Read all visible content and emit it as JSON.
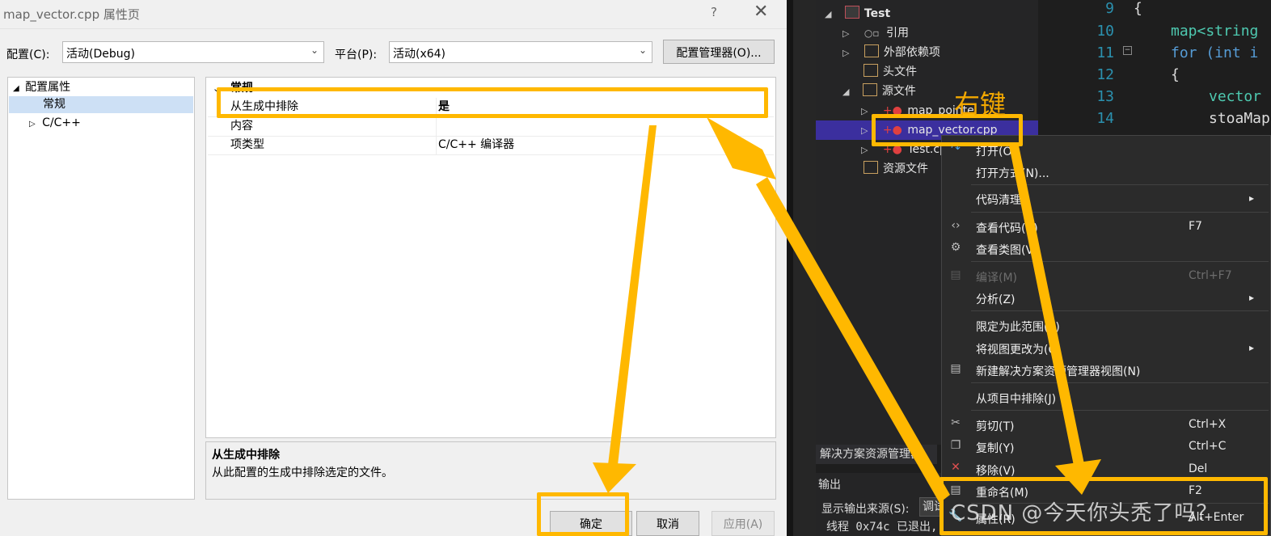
{
  "dialog": {
    "title": "map_vector.cpp 属性页",
    "help": "?",
    "close": "✕",
    "config_label": "配置(C):",
    "config_value": "活动(Debug)",
    "platform_label": "平台(P):",
    "platform_value": "活动(x64)",
    "config_manager_button": "配置管理器(O)...",
    "tree": {
      "root": "配置属性",
      "general": "常规",
      "cpp": "C/C++"
    },
    "grid": {
      "section": "常规",
      "rows": [
        {
          "name": "从生成中排除",
          "value": "是"
        },
        {
          "name": "内容",
          "value": ""
        },
        {
          "name": "项类型",
          "value": "C/C++ 编译器"
        }
      ]
    },
    "description": {
      "title": "从生成中排除",
      "text": "从此配置的生成中排除选定的文件。"
    },
    "buttons": {
      "ok": "确定",
      "cancel": "取消",
      "apply": "应用(A)"
    }
  },
  "solution_explorer": {
    "project": "Test",
    "items": {
      "references": "引用",
      "external_deps": "外部依赖项",
      "headers": "头文件",
      "sources": "源文件",
      "file1": "map_pointe",
      "file2": "map_vector.cpp",
      "file3": "Test.cp",
      "resources": "资源文件"
    },
    "footer_tab": "解决方案资源管理器"
  },
  "code": {
    "lines": [
      {
        "n": "9",
        "text": "{"
      },
      {
        "n": "10",
        "text": "map<string"
      },
      {
        "n": "11",
        "text": "for (int i"
      },
      {
        "n": "12",
        "text": "{"
      },
      {
        "n": "13",
        "text": "vector"
      },
      {
        "n": "14",
        "text": "stoaMap"
      }
    ]
  },
  "output": {
    "title": "输出",
    "source_label": "显示输出来源(S):",
    "source_value": "调试",
    "line": "线程 0x74c 已退出,"
  },
  "context_menu": {
    "open": "打开(O)",
    "open_with": "打开方式(N)...",
    "code_cleanup": "代码清理",
    "view_code": "查看代码(C)",
    "view_code_sc": "F7",
    "view_class": "查看类图(V)",
    "compile": "编译(M)",
    "compile_sc": "Ctrl+F7",
    "analyze": "分析(Z)",
    "scope": "限定为此范围(S)",
    "change_view": "将视图更改为(C)",
    "new_view": "新建解决方案资源管理器视图(N)",
    "exclude": "从项目中排除(J)",
    "cut": "剪切(T)",
    "cut_sc": "Ctrl+X",
    "copy": "复制(Y)",
    "copy_sc": "Ctrl+C",
    "remove": "移除(V)",
    "remove_sc": "Del",
    "rename": "重命名(M)",
    "rename_sc": "F2",
    "properties": "属性(R)",
    "properties_sc": "Alt+Enter"
  },
  "annotations": {
    "right_click_note": "右键",
    "watermark": "CSDN @今天你头秃了吗？",
    "highlight_color": "#ffb800"
  }
}
